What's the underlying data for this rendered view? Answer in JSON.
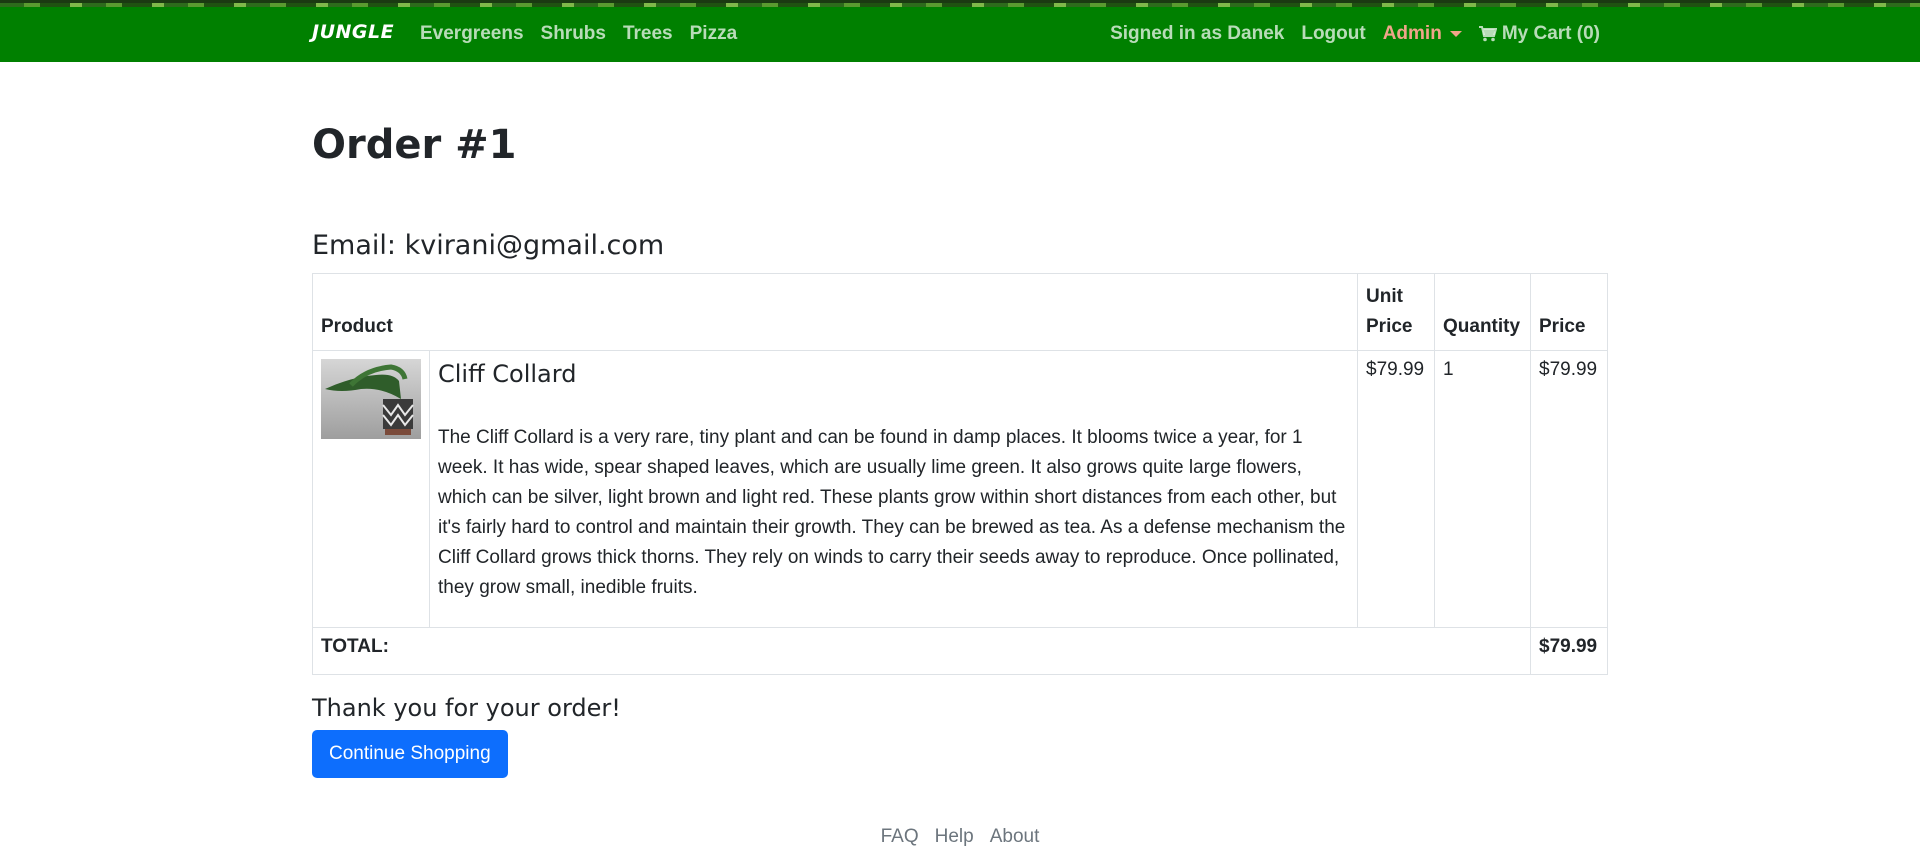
{
  "navbar": {
    "brand": "JUNGLE",
    "categories": [
      "Evergreens",
      "Shrubs",
      "Trees",
      "Pizza"
    ],
    "signed_in": "Signed in as Danek",
    "logout": "Logout",
    "admin": "Admin",
    "cart": "My Cart (0)",
    "cart_icon": "shopping-cart-icon",
    "colors": {
      "bg": "#008000",
      "admin": "#f0a58a"
    }
  },
  "order": {
    "title": "Order #1",
    "email": "Email: kvirani@gmail.com",
    "headers": {
      "product": "Product",
      "unit_price": "Unit Price",
      "quantity": "Quantity",
      "price": "Price"
    },
    "items": [
      {
        "name": "Cliff Collard",
        "description": "The Cliff Collard is a very rare, tiny plant and can be found in damp places. It blooms twice a year, for 1 week. It has wide, spear shaped leaves, which are usually lime green. It also grows quite large flowers, which can be silver, light brown and light red. These plants grow within short distances from each other, but it's fairly hard to control and maintain their growth. They can be brewed as tea. As a defense mechanism the Cliff Collard grows thick thorns. They rely on winds to carry their seeds away to reproduce. Once pollinated, they grow small, inedible fruits.",
        "unit_price": "$79.99",
        "quantity": "1",
        "price": "$79.99"
      }
    ],
    "total_label": "TOTAL:",
    "total": "$79.99",
    "thanks": "Thank you for your order!",
    "continue_button": "Continue Shopping",
    "button_color": "#0d6efd"
  },
  "footer": {
    "links": [
      "FAQ",
      "Help",
      "About"
    ]
  }
}
